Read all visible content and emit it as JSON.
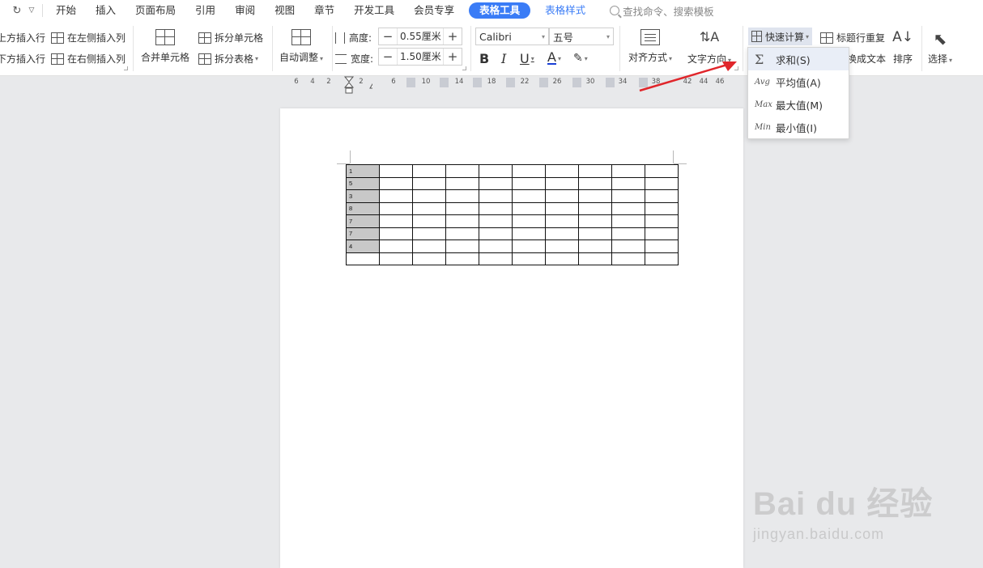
{
  "menubar": {
    "items": [
      "开始",
      "插入",
      "页面布局",
      "引用",
      "审阅",
      "视图",
      "章节",
      "开发工具",
      "会员专享"
    ],
    "active_tab": "表格工具",
    "sub_tab": "表格样式",
    "search_placeholder": "查找命令、搜索模板"
  },
  "ribbon": {
    "insert_row_above": "上方插入行",
    "insert_row_below": "下方插入行",
    "insert_col_left": "在左侧插入列",
    "insert_col_right": "在右侧插入列",
    "merge_cells": "合并单元格",
    "split_cells": "拆分单元格",
    "split_table": "拆分表格",
    "auto_fit": "自动调整",
    "height_label": "高度:",
    "height_value": "0.55厘米",
    "width_label": "宽度:",
    "width_value": "1.50厘米",
    "font_name": "Calibri",
    "font_size": "五号",
    "align": "对齐方式",
    "text_direction": "文字方向",
    "quick_calc": "快速计算",
    "repeat_header": "标题行重复",
    "convert_text": "换成文本",
    "sort": "排序",
    "select": "选择"
  },
  "dropdown": {
    "items": [
      {
        "icon": "Σ",
        "label": "求和(S)"
      },
      {
        "icon": "Avg",
        "label": "平均值(A)"
      },
      {
        "icon": "Max",
        "label": "最大值(M)"
      },
      {
        "icon": "Min",
        "label": "最小值(I)"
      }
    ]
  },
  "ruler": {
    "ticks": [
      "6",
      "4",
      "2",
      "2",
      "6",
      "10",
      "14",
      "18",
      "22",
      "26",
      "30",
      "34",
      "38",
      "42",
      "44",
      "46"
    ]
  },
  "table": {
    "first_col": [
      "1",
      "5",
      "3",
      "8",
      "7",
      "7",
      "4",
      ""
    ],
    "columns": 10
  },
  "watermark": {
    "logo": "Bai du 经验",
    "url": "jingyan.baidu.com"
  },
  "colors": {
    "accent": "#3a7cf6",
    "arrow": "#e0262b",
    "selected_cell": "#c8c8c8"
  }
}
